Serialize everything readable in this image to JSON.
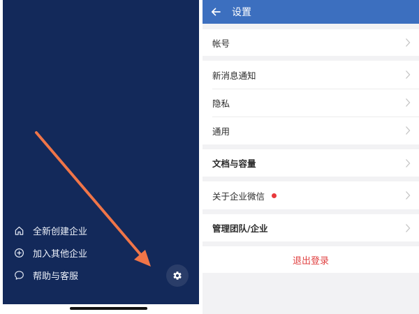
{
  "left_menu": {
    "items": [
      {
        "label": "全新创建企业",
        "icon": "home-icon"
      },
      {
        "label": "加入其他企业",
        "icon": "plus-circle-icon"
      },
      {
        "label": "帮助与客服",
        "icon": "chat-bubble-icon"
      }
    ],
    "settings_icon": "gear-icon"
  },
  "settings": {
    "title": "设置",
    "rows": {
      "account": "帐号",
      "notifications": "新消息通知",
      "privacy": "隐私",
      "general": "通用",
      "storage": "文档与容量",
      "about": "关于企业微信",
      "manage": "管理团队/企业",
      "logout": "退出登录"
    }
  },
  "colors": {
    "left_bg": "#13295a",
    "header_bg": "#3c6fbf",
    "arrow": "#f07548",
    "dot": "#e8393c",
    "logout_text": "#e04141"
  }
}
